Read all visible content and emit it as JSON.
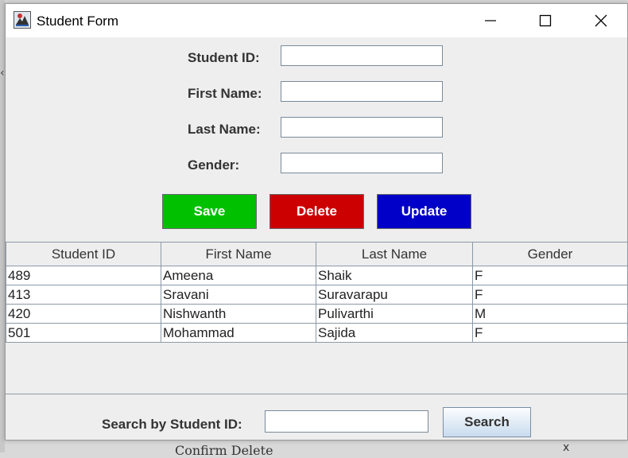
{
  "window": {
    "title": "Student Form"
  },
  "form": {
    "student_id_label": "Student ID:",
    "first_name_label": "First Name:",
    "last_name_label": "Last Name:",
    "gender_label": "Gender:",
    "student_id_value": "",
    "first_name_value": "",
    "last_name_value": "",
    "gender_value": ""
  },
  "buttons": {
    "save_label": "Save",
    "delete_label": "Delete",
    "update_label": "Update",
    "save_color": "#00c000",
    "delete_color": "#cc0000",
    "update_color": "#0000c8"
  },
  "table": {
    "headers": [
      "Student ID",
      "First Name",
      "Last Name",
      "Gender"
    ],
    "rows": [
      [
        "489",
        "Ameena",
        "Shaik",
        "F"
      ],
      [
        "413",
        "Sravani",
        "Suravarapu",
        "F"
      ],
      [
        "420",
        "Nishwanth",
        "Pulivarthi",
        "M"
      ],
      [
        "501",
        "Mohammad",
        "Sajida",
        "F"
      ]
    ]
  },
  "search": {
    "label": "Search by Student ID:",
    "value": "",
    "button_label": "Search"
  },
  "background": {
    "behind_caret": "‹",
    "behind_dialog_title": "Confirm Delete",
    "behind_close": "x"
  }
}
